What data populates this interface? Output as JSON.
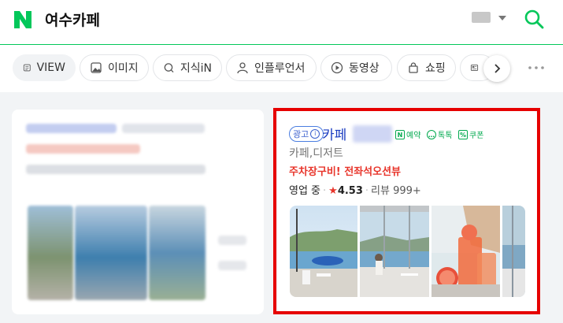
{
  "header": {
    "query": "여수카페",
    "logo_icon": "naver-n-logo",
    "keyboard_icon": "keyboard-icon",
    "search_icon": "search-icon",
    "brand_color": "#03c75a"
  },
  "tabs": [
    {
      "label": "VIEW",
      "icon": "view-icon"
    },
    {
      "label": "이미지",
      "icon": "image-icon"
    },
    {
      "label": "지식iN",
      "icon": "knowledge-icon"
    },
    {
      "label": "인플루언서",
      "icon": "person-icon"
    },
    {
      "label": "동영상",
      "icon": "play-icon"
    },
    {
      "label": "쇼핑",
      "icon": "shopping-bag-icon"
    }
  ],
  "ad": {
    "badge": "광고",
    "badge_info": "i",
    "name": "카페",
    "services": [
      {
        "label": "예약",
        "mark": "N",
        "icon": "reservation-icon"
      },
      {
        "label": "톡톡",
        "mark": "…",
        "icon": "talk-icon"
      },
      {
        "label": "쿠폰",
        "mark": "%",
        "icon": "coupon-icon"
      }
    ],
    "category": "카페,디저트",
    "promo": "주차장구비! 전좌석오션뷰",
    "status": "영업 중",
    "rating": "4.53",
    "review_label": "리뷰",
    "review_count": "999+",
    "highlight_color": "#e60000"
  }
}
